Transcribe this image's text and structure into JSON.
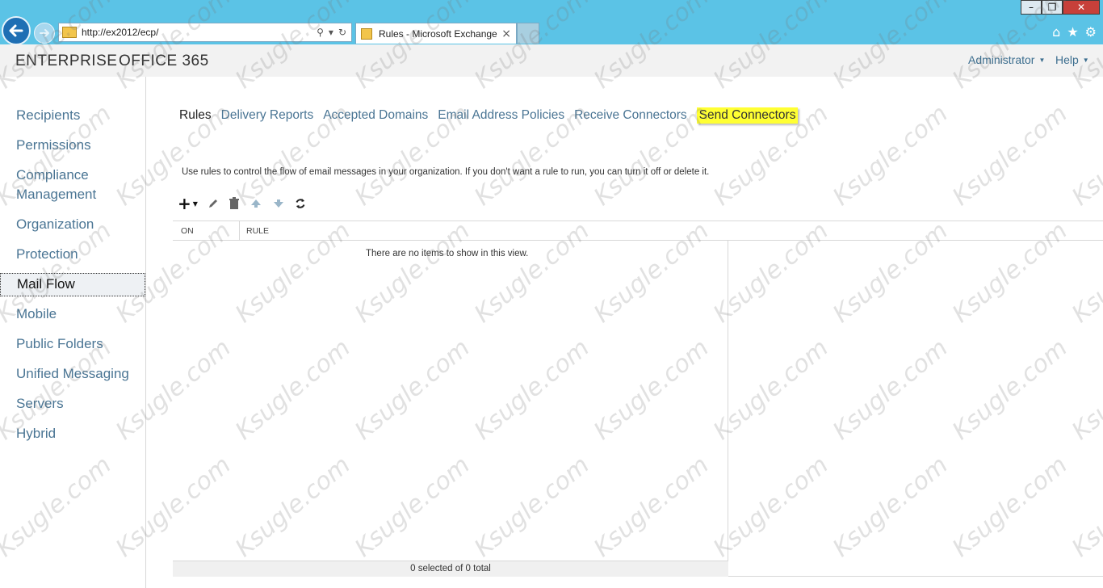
{
  "browser": {
    "address": "http://ex2012/ecp/",
    "tab_title": "Rules - Microsoft Exchange",
    "tab_close": "×",
    "window_controls": {
      "minimize": "–",
      "restore": "❐",
      "close": "✕"
    },
    "icons": [
      "home-icon",
      "star-icon",
      "gear-icon"
    ]
  },
  "header": {
    "brand_enterprise": "ENTERPRISE",
    "brand_office365": "OFFICE 365",
    "user": "Administrator",
    "help": "Help"
  },
  "sidebar": {
    "items": [
      {
        "label": "Recipients"
      },
      {
        "label": "Permissions"
      },
      {
        "label": "Compliance Management"
      },
      {
        "label": "Organization"
      },
      {
        "label": "Protection"
      },
      {
        "label": "Mail Flow",
        "active": true
      },
      {
        "label": "Mobile"
      },
      {
        "label": "Public Folders"
      },
      {
        "label": "Unified Messaging"
      },
      {
        "label": "Servers"
      },
      {
        "label": "Hybrid"
      }
    ]
  },
  "main": {
    "tabs": [
      {
        "label": "Rules",
        "current": true
      },
      {
        "label": "Delivery Reports"
      },
      {
        "label": "Accepted Domains"
      },
      {
        "label": "Email Address Policies"
      },
      {
        "label": "Receive Connectors"
      },
      {
        "label": "Send Connectors",
        "highlighted": true
      }
    ],
    "description": "Use rules to control the flow of email messages in your organization. If you don't want a rule to run, you can turn it off or delete it.",
    "columns": {
      "on": "ON",
      "rule": "RULE"
    },
    "empty_message": "There are no items to show in this view.",
    "status": "0 selected of 0 total"
  },
  "watermark": "Ksugle.com",
  "colors": {
    "browser_bar": "#5bc3e6",
    "link": "#4a7594",
    "highlight": "#ffff33"
  }
}
